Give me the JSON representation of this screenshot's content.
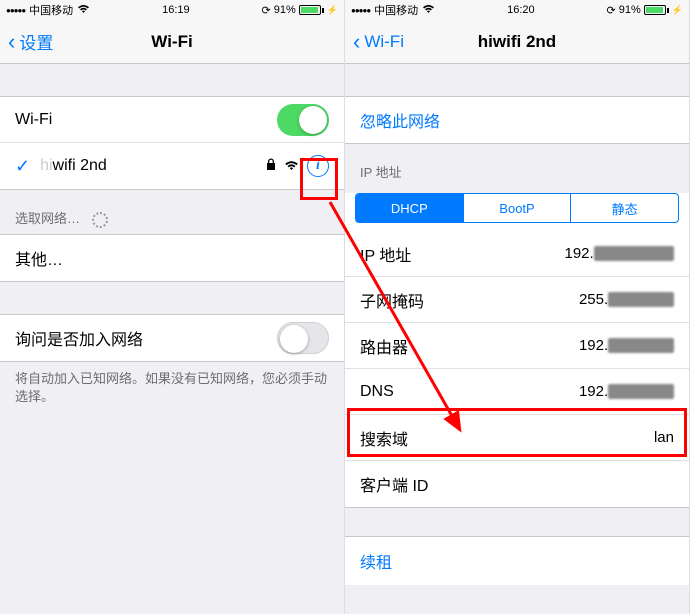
{
  "left": {
    "status": {
      "carrier": "中国移动",
      "time": "16:19",
      "battery": "91%"
    },
    "nav": {
      "back": "设置",
      "title": "Wi-Fi"
    },
    "wifi_row": {
      "label": "Wi-Fi"
    },
    "network": {
      "name": "hiwifi 2nd",
      "faded_prefix": "hi"
    },
    "choose_header": "选取网络…",
    "other": "其他…",
    "ask_join": "询问是否加入网络",
    "footer": "将自动加入已知网络。如果没有已知网络，您必须手动选择。"
  },
  "right": {
    "status": {
      "carrier": "中国移动",
      "time": "16:20",
      "battery": "91%"
    },
    "nav": {
      "back": "Wi-Fi",
      "title": "hiwifi 2nd"
    },
    "forget": "忽略此网络",
    "ip_header": "IP 地址",
    "tabs": {
      "dhcp": "DHCP",
      "bootp": "BootP",
      "static": "静态"
    },
    "rows": {
      "ip_label": "IP 地址",
      "ip_value_prefix": "192.",
      "ip_value_blur": "168.199.128",
      "subnet_label": "子网掩码",
      "subnet_value_prefix": "255.",
      "subnet_value_blur": "255.255.0",
      "router_label": "路由器",
      "router_value_prefix": "192.",
      "router_value_blur": "168.199.1",
      "dns_label": "DNS",
      "dns_value_prefix": "192.",
      "dns_value_blur": "168.199.1",
      "search_label": "搜索域",
      "search_value": "lan",
      "client_label": "客户端 ID"
    },
    "renew": "续租"
  }
}
